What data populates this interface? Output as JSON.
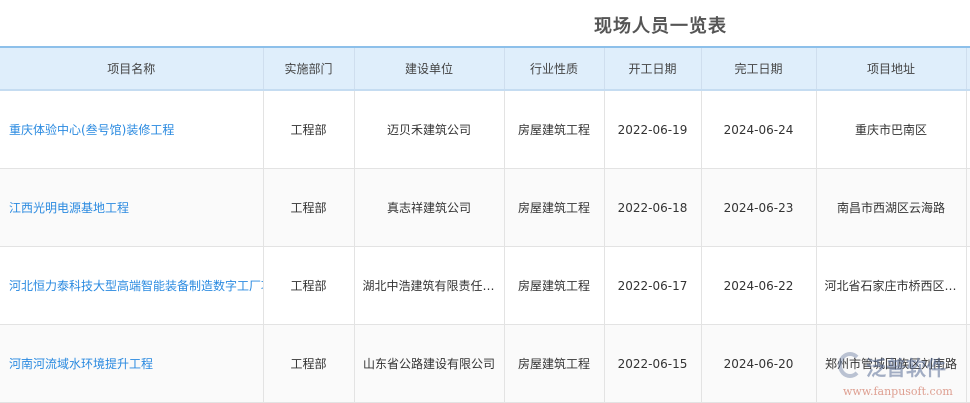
{
  "title": "现场人员一览表",
  "headers": [
    "项目名称",
    "实施部门",
    "建设单位",
    "行业性质",
    "开工日期",
    "完工日期",
    "项目地址"
  ],
  "rows": [
    [
      "重庆体验中心(叁号馆)装修工程",
      "工程部",
      "迈贝禾建筑公司",
      "房屋建筑工程",
      "2022-06-19",
      "2024-06-24",
      "重庆市巴南区"
    ],
    [
      "江西光明电源基地工程",
      "工程部",
      "真志祥建筑公司",
      "房屋建筑工程",
      "2022-06-18",
      "2024-06-23",
      "南昌市西湖区云海路"
    ],
    [
      "河北恒力泰科技大型高端智能装备制造数字工厂项目",
      "工程部",
      "湖北中浩建筑有限责任公司",
      "房屋建筑工程",
      "2022-06-17",
      "2024-06-22",
      "河北省石家庄市桥西区某路"
    ],
    [
      "河南河流域水环境提升工程",
      "工程部",
      "山东省公路建设有限公司",
      "房屋建筑工程",
      "2022-06-15",
      "2024-06-20",
      "郑州市管城回族区刘南路"
    ]
  ],
  "watermark": {
    "brand": "泛普软件",
    "url": "www.fanpusoft.com"
  }
}
